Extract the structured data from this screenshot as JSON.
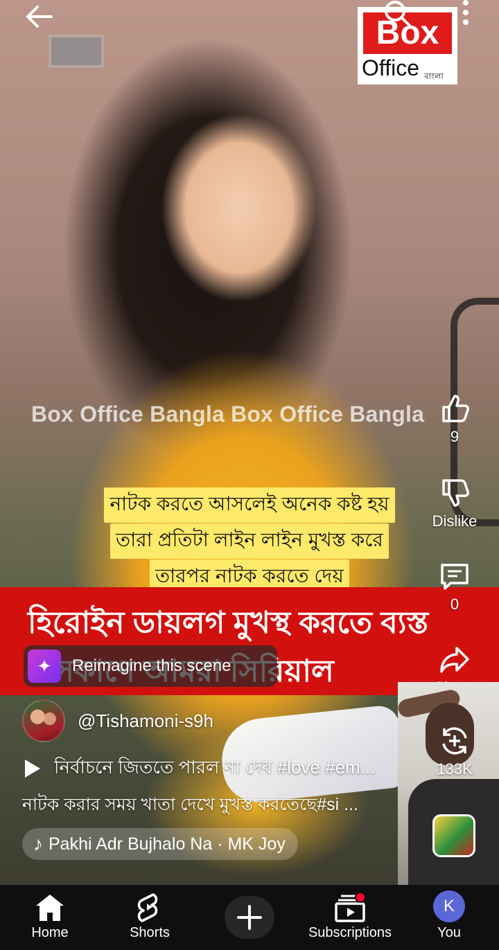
{
  "overlay": {
    "watermark": "Box Office Bangla  Box Office Bangla",
    "caption_lines": [
      "নাটক করতে আসলেই অনেক কষ্ট হয়",
      "তারা প্রতিটা লাইন লাইন মুখস্ত করে",
      "তারপর নাটক করতে দেয়"
    ],
    "banner_line1": "হিরোইন ডায়লগ মুখস্থ করতে ব্যস্ত",
    "banner_line2": "সেকাণে আমরা সিরিয়াল",
    "logo_top": "Box",
    "logo_bottom": "Office",
    "logo_sub": "বাংলা"
  },
  "actions": {
    "like_count": "9",
    "dislike_label": "Dislike",
    "comments_count": "0",
    "share_label": "Share",
    "remix_count": "133K"
  },
  "reimagine": {
    "label": "Reimagine this scene"
  },
  "channel": {
    "handle": "@Tishamoni-s9h"
  },
  "description": {
    "line1": "নির্বাচনে জিততে পারল না দেব #love #em...",
    "line2": "নাটক করার সময় খাতা দেখে মুখস্ত করতেছে#si ..."
  },
  "music": {
    "label": "Pakhi Adr Bujhalo Na · MK Joy"
  },
  "nav": {
    "home": "Home",
    "shorts": "Shorts",
    "subscriptions": "Subscriptions",
    "you": "You",
    "you_initial": "K"
  }
}
